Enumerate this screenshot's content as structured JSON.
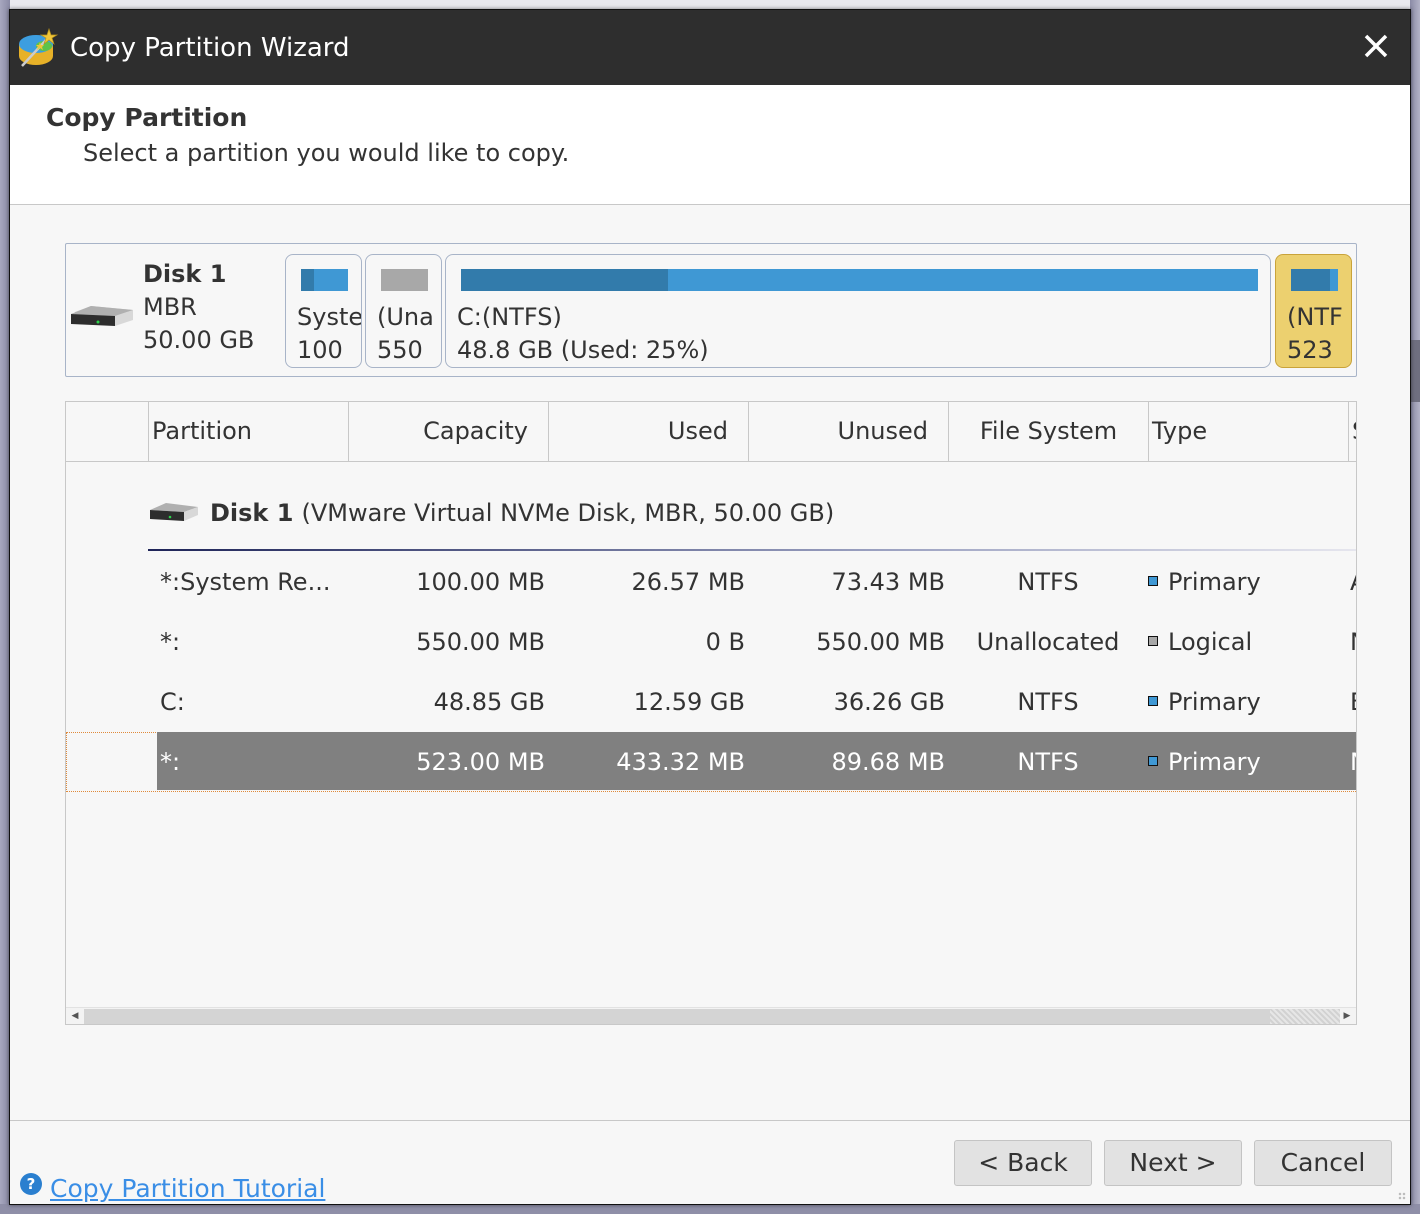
{
  "window": {
    "title": "Copy Partition Wizard",
    "close_icon": "close-icon"
  },
  "header": {
    "title": "Copy Partition",
    "subtitle": "Select a partition you would like to copy."
  },
  "disk_map": {
    "disk": {
      "name": "Disk 1",
      "scheme": "MBR",
      "size": "50.00 GB"
    },
    "partitions": [
      {
        "label": "Syste",
        "size": "100",
        "used_fraction": 0.27,
        "color": "#3f98d4",
        "used_color": "#327bab",
        "selected": false
      },
      {
        "label": "(Una",
        "size": "550",
        "used_fraction": 0,
        "color": "#a8a8a8",
        "used_color": "#a8a8a8",
        "selected": false
      },
      {
        "label": "C:(NTFS)",
        "size": "48.8 GB (Used: 25%)",
        "used_fraction": 0.26,
        "color": "#3f98d4",
        "used_color": "#327bab",
        "selected": false
      },
      {
        "label": "(NTF",
        "size": "523",
        "used_fraction": 0.83,
        "color": "#3f98d4",
        "used_color": "#327bab",
        "selected": true
      }
    ]
  },
  "table": {
    "columns": [
      "Partition",
      "Capacity",
      "Used",
      "Unused",
      "File System",
      "Type",
      "S"
    ],
    "disk_header": {
      "name": "Disk 1",
      "detail": "(VMware Virtual NVMe Disk, MBR, 50.00 GB)"
    },
    "rows": [
      {
        "partition": "*:System Re...",
        "capacity": "100.00 MB",
        "used": "26.57 MB",
        "unused": "73.43 MB",
        "fs": "NTFS",
        "type": "Primary",
        "type_color": "#3f98d4",
        "status": "A",
        "selected": false
      },
      {
        "partition": "*:",
        "capacity": "550.00 MB",
        "used": "0 B",
        "unused": "550.00 MB",
        "fs": "Unallocated",
        "type": "Logical",
        "type_color": "#a8a8a8",
        "status": "N",
        "selected": false
      },
      {
        "partition": "C:",
        "capacity": "48.85 GB",
        "used": "12.59 GB",
        "unused": "36.26 GB",
        "fs": "NTFS",
        "type": "Primary",
        "type_color": "#3f98d4",
        "status": "B",
        "selected": false
      },
      {
        "partition": "*:",
        "capacity": "523.00 MB",
        "used": "433.32 MB",
        "unused": "89.68 MB",
        "fs": "NTFS",
        "type": "Primary",
        "type_color": "#3f98d4",
        "status": "N",
        "selected": true
      }
    ]
  },
  "footer": {
    "help_link": "Copy Partition Tutorial",
    "back_label": "< Back",
    "next_label": "Next >",
    "cancel_label": "Cancel"
  }
}
